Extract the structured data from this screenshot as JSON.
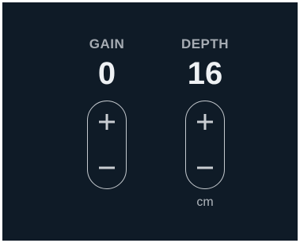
{
  "gain": {
    "label": "GAIN",
    "value": "0",
    "increment_icon": "plus-icon",
    "decrement_icon": "minus-icon"
  },
  "depth": {
    "label": "DEPTH",
    "value": "16",
    "unit": "cm",
    "increment_icon": "plus-icon",
    "decrement_icon": "minus-icon"
  },
  "colors": {
    "background": "#0f1b27",
    "label": "#a6acb3",
    "value": "#eef1f4",
    "control_outline": "#c4c9ce"
  }
}
